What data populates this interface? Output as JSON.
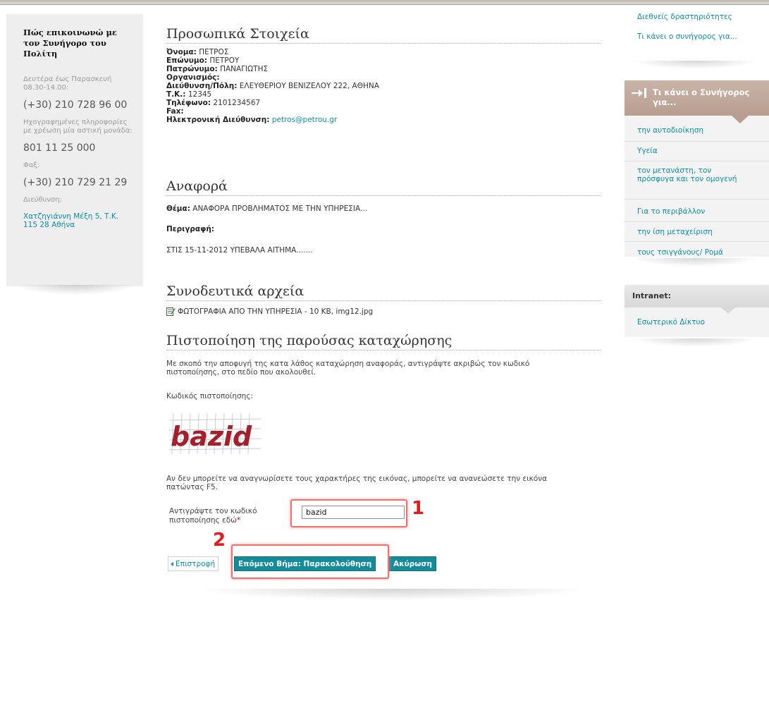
{
  "contact": {
    "title": "Πώς επικοινωνώ με τον Συνήγορο του Πολίτη",
    "hours_label": "Δευτέρα έως Παρασκευή 08.30-14.00:",
    "phone": "(+30) 210 728 96 00",
    "recorded_label": "Ηχογραφημένες πληροφορίες με χρέωση μία αστική μονάδα:",
    "recorded_phone": "801 11 25 000",
    "fax_label": "Φαξ:",
    "fax": "(+30) 210 729 21 29",
    "address_label": "Διεύθυνση:",
    "address": "Χατζηγιάννη Μέξη 5, Τ.Κ. 115 28 Αθήνα"
  },
  "personal": {
    "title": "Προσωπικά Στοιχεία",
    "fields": [
      {
        "label": "Όνομα:",
        "value": "ΠΕΤΡΟΣ"
      },
      {
        "label": "Επώνυμο:",
        "value": "ΠΕΤΡΟΥ"
      },
      {
        "label": "Πατρώνυμο:",
        "value": "ΠΑΝΑΓΙΩΤΗΣ"
      },
      {
        "label": "Οργανισμός:",
        "value": ""
      },
      {
        "label": "Διεύθυνση/Πόλη:",
        "value": "ΕΛΕΥΘΕΡΙΟΥ ΒΕΝΙΖΕΛΟΥ 222, ΑΘΗΝΑ"
      },
      {
        "label": "Τ.Κ.:",
        "value": "12345"
      },
      {
        "label": "Τηλέφωνο:",
        "value": "2101234567"
      },
      {
        "label": "Fax:",
        "value": ""
      }
    ],
    "email_label": "Ηλεκτρονική Διεύθυνση:",
    "email": "petros@petrou.gr"
  },
  "report": {
    "title": "Αναφορά",
    "subject_label": "Θέμα:",
    "subject": "ΑΝΑΦΟΡΑ ΠΡΟΒΛΗΜΑΤΟΣ ΜΕ ΤΗΝ ΥΠΗΡΕΣΙΑ...",
    "description_label": "Περιγραφή:",
    "description": "ΣΤΙΣ 15-11-2012 ΥΠΕΒΑΛΑ ΑΙΤΗΜΑ......."
  },
  "attachments": {
    "title": "Συνοδευτικά αρχεία",
    "file": "ΦΩΤΟΓΡΑΦΙΑ ΑΠΟ ΤΗΝ ΥΠΗΡΕΣΙΑ - 10 KB, img12.jpg",
    "file_icon": "document-edit-icon"
  },
  "verification": {
    "title": "Πιστοποίηση της παρούσας καταχώρησης",
    "intro": "Με σκοπό την αποφυγή της κατα λάθος καταχώρηση αναφοράς, αντιγράψτε ακριβώς τον κωδικό πιστοποίησης, στο πεδίο που ακολουθεί.",
    "code_label": "Κωδικός πιστοποίησης:",
    "captcha_text": "bazid",
    "refresh_note": "Αν δεν μπορείτε να αναγνωρίσετε τους χαρακτήρες της εικόνας, μπορείτε να ανανεώσετε την εικόνα πατώντας F5.",
    "input_label": "Αντιγράψτε τον κωδικό πιστοποίησης εδώ",
    "required_mark": "*",
    "input_value": "bazid"
  },
  "annotations": {
    "step1": "1",
    "step2": "2"
  },
  "buttons": {
    "back": "Επιστροφή",
    "next": "Επόμενο Βήμα: Παρακολούθηση",
    "cancel": "Ακύρωση"
  },
  "right": {
    "top_links": [
      "Διεθνείς δραστηριότητες",
      "Τι κάνει ο συνήγορος για..."
    ],
    "panel_title": "Τι κάνει ο Συνήγορος για...",
    "panel_items": [
      "την αυτοδιοίκηση",
      "Υγεία",
      "τον μετανάστη, τον πρόσφυγα και τον ομογενή",
      "Για το περιβάλλον",
      "την ίση μεταχείριση",
      "τους τσιγγάνους/ Ρομά"
    ],
    "intranet_title": "Intranet:",
    "intranet_item": "Εσωτερικό Δίκτυο"
  },
  "colors": {
    "accent": "#138b98",
    "link": "#0a8fa3",
    "highlight": "#e31b1b",
    "panel_head": "#b79e90"
  }
}
